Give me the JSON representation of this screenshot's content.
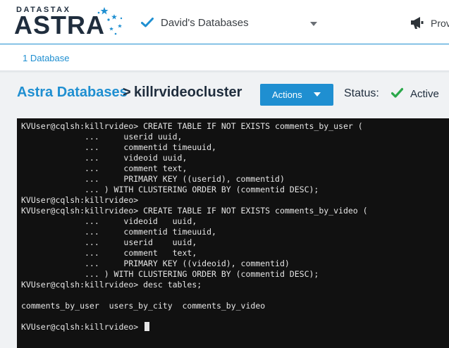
{
  "header": {
    "brand_small": "DATASTAX",
    "brand_big": "ASTRA",
    "database_selector": "David's Databases",
    "right_item_label": "Prov"
  },
  "subnav": {
    "database_count_link": "1 Database"
  },
  "title_row": {
    "breadcrumb_root": "Astra Databases",
    "breadcrumb_separator": ">",
    "breadcrumb_current": "killrvideocluster",
    "actions_label": "Actions",
    "status_label": "Status:",
    "status_value": "Active"
  },
  "terminal": {
    "lines": [
      "KVUser@cqlsh:killrvideo> CREATE TABLE IF NOT EXISTS comments_by_user (",
      "             ...     userid uuid,",
      "             ...     commentid timeuuid,",
      "             ...     videoid uuid,",
      "             ...     comment text,",
      "             ...     PRIMARY KEY ((userid), commentid)",
      "             ... ) WITH CLUSTERING ORDER BY (commentid DESC);",
      "KVUser@cqlsh:killrvideo>",
      "KVUser@cqlsh:killrvideo> CREATE TABLE IF NOT EXISTS comments_by_video (",
      "             ...     videoid   uuid,",
      "             ...     commentid timeuuid,",
      "             ...     userid    uuid,",
      "             ...     comment   text,",
      "             ...     PRIMARY KEY ((videoid), commentid)",
      "             ... ) WITH CLUSTERING ORDER BY (commentid DESC);",
      "KVUser@cqlsh:killrvideo> desc tables;",
      "",
      "comments_by_user  users_by_city  comments_by_video",
      "",
      "KVUser@cqlsh:killrvideo>"
    ]
  },
  "colors": {
    "accent": "#1f8fd1",
    "success": "#2aa84a",
    "terminal_bg": "#111111",
    "terminal_fg": "#e6e6e6"
  },
  "icons": [
    "star-cluster-icon",
    "check-icon",
    "chevron-down-icon",
    "megaphone-icon"
  ]
}
